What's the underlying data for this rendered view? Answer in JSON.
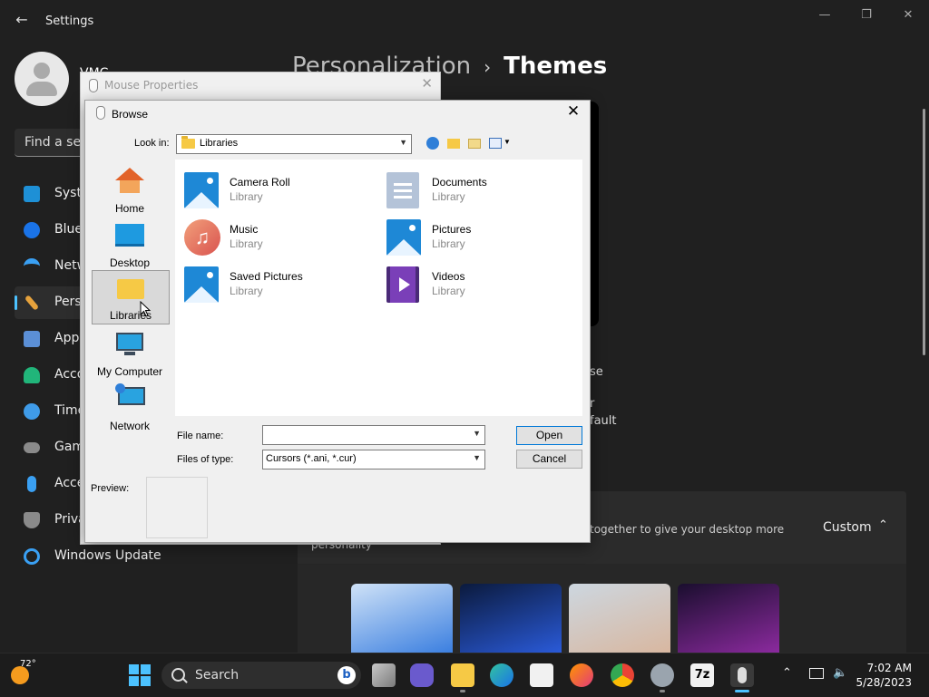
{
  "settings": {
    "app_title": "Settings",
    "user_name": "VMC",
    "search_placeholder": "Find a set",
    "nav": [
      {
        "label": "Syste",
        "icon": "system-icon",
        "color": "#1e90d6"
      },
      {
        "label": "Blue",
        "icon": "bluetooth-icon",
        "color": "#1a73e8"
      },
      {
        "label": "Netw",
        "icon": "wifi-icon",
        "color": "#3aa0f3"
      },
      {
        "label": "Pers",
        "icon": "brush-icon",
        "color": "#e6a23c"
      },
      {
        "label": "App",
        "icon": "apps-icon",
        "color": "#5b8fd6"
      },
      {
        "label": "Acco",
        "icon": "account-icon",
        "color": "#21b57a"
      },
      {
        "label": "Time",
        "icon": "clock-icon",
        "color": "#3f9be8"
      },
      {
        "label": "Gam",
        "icon": "gamepad-icon",
        "color": "#8a8a8a"
      },
      {
        "label": "Acces",
        "icon": "accessibility-icon",
        "color": "#3aa0f3"
      },
      {
        "label": "Priva",
        "icon": "shield-icon",
        "color": "#8a8a8a"
      },
      {
        "label": "Windows Update",
        "icon": "update-icon",
        "color": "#3aa0f3"
      }
    ],
    "breadcrumb_parent": "Personalization",
    "breadcrumb_sep": "›",
    "breadcrumb_current": "Themes",
    "side_text_1": "se",
    "side_text_2": "r",
    "side_text_3": "fault",
    "custom_panel_desc": "together to give your desktop more",
    "custom_panel_desc2": "personality",
    "custom_panel_value": "Custom"
  },
  "mouse_properties": {
    "title": "Mouse Properties"
  },
  "browse": {
    "title": "Browse",
    "look_in_label": "Look in:",
    "look_in_value": "Libraries",
    "places": [
      {
        "label": "Home",
        "icon": "home-icon"
      },
      {
        "label": "Desktop",
        "icon": "desktop-icon"
      },
      {
        "label": "Libraries",
        "icon": "libraries-folder-icon"
      },
      {
        "label": "My Computer",
        "icon": "computer-icon"
      },
      {
        "label": "Network",
        "icon": "network-icon"
      }
    ],
    "items": [
      {
        "name": "Camera Roll",
        "type": "Library",
        "icon": "picture-library-icon"
      },
      {
        "name": "Documents",
        "type": "Library",
        "icon": "documents-library-icon"
      },
      {
        "name": "Music",
        "type": "Library",
        "icon": "music-library-icon"
      },
      {
        "name": "Pictures",
        "type": "Library",
        "icon": "picture-library-icon"
      },
      {
        "name": "Saved Pictures",
        "type": "Library",
        "icon": "picture-library-icon"
      },
      {
        "name": "Videos",
        "type": "Library",
        "icon": "videos-library-icon"
      }
    ],
    "file_name_label": "File name:",
    "file_name_value": "",
    "file_type_label": "Files of type:",
    "file_type_value": "Cursors (*.ani, *.cur)",
    "open_label": "Open",
    "cancel_label": "Cancel",
    "preview_label": "Preview:"
  },
  "taskbar": {
    "weather_temp": "72°",
    "search_label": "Search",
    "time": "7:02 AM",
    "date": "5/28/2023",
    "apps": [
      "task-view-icon",
      "chat-icon",
      "file-explorer-icon",
      "edge-icon",
      "store-icon",
      "firefox-icon",
      "chrome-icon",
      "settings-icon",
      "7zip-icon",
      "mouse-icon"
    ],
    "seven_zip_label": "7z"
  }
}
